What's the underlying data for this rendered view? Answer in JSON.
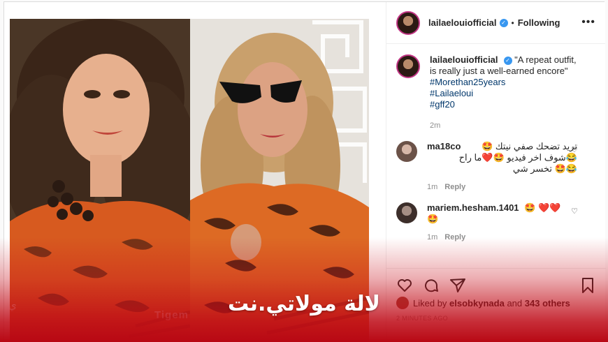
{
  "post": {
    "username": "lailaelouiofficial",
    "follow_state": "Following",
    "header_dot": "•",
    "caption": "\"A repeat outfit, is really just a well-earned encore\"",
    "hashtags": [
      "#Morethan25years",
      "#Lailaeloui",
      "#gff20"
    ],
    "caption_time": "2m"
  },
  "comments": [
    {
      "username": "ma18co",
      "lines": [
        "تريد تضحك صفي نيتك 🤩",
        "😂شوف اخر فيديو 🤩❤️ما راح",
        "😂🤩 تخسر شي"
      ],
      "time": "1m",
      "reply_label": "Reply"
    },
    {
      "username": "mariem.hesham.1401",
      "lines": [
        "🤩 ❤️❤️",
        "🤩"
      ],
      "time": "1m",
      "reply_label": "Reply"
    }
  ],
  "likes": {
    "liked_by_prefix": "Liked by",
    "liked_by_user": "elsobkynada",
    "and_label": "and",
    "others": "343 others"
  },
  "time_ago": "2 MINUTES AGO",
  "watermark": "Tigem",
  "brand_text": "لالة مولاتي.نت",
  "colors": {
    "brand_red": "#b80814",
    "hashtag_blue": "#00376b",
    "verified_blue": "#3897f0"
  },
  "icons": [
    "more-icon",
    "heart-icon",
    "comment-icon",
    "share-icon",
    "bookmark-icon",
    "verified-icon"
  ]
}
